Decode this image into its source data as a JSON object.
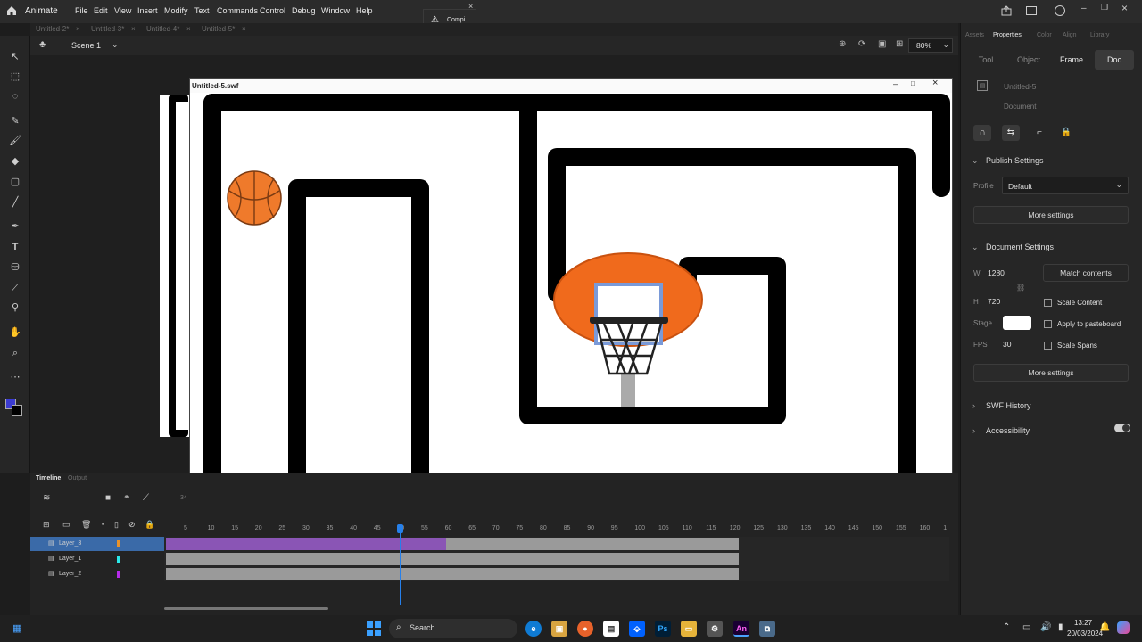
{
  "app": {
    "name": "Animate",
    "menu": [
      "File",
      "Edit",
      "View",
      "Insert",
      "Modify",
      "Text",
      "Commands",
      "Control",
      "Debug",
      "Window",
      "Help"
    ],
    "notification": "Compi..."
  },
  "doc_tabs": [
    "Untitled-2*",
    "Untitled-3*",
    "Untitled-4*",
    "Untitled-5*"
  ],
  "scene": {
    "name": "Scene 1",
    "zoom": "80%"
  },
  "swf_window": {
    "title": "Untitled-5.swf"
  },
  "right_panel": {
    "tabs": [
      "Assets",
      "Properties",
      "Color",
      "Align",
      "Library"
    ],
    "active_tab": "Properties",
    "segments": [
      "Tool",
      "Object",
      "Frame",
      "Doc"
    ],
    "active_segment": "Doc",
    "doc_name": "Untitled-5",
    "doc_type": "Document",
    "publish_settings": {
      "title": "Publish Settings",
      "profile_label": "Profile",
      "profile_value": "Default",
      "more_settings": "More settings"
    },
    "document_settings": {
      "title": "Document Settings",
      "w_label": "W",
      "w_value": "1280",
      "h_label": "H",
      "h_value": "720",
      "match_contents": "Match contents",
      "scale_content": "Scale Content",
      "stage_label": "Stage",
      "stage_color": "#ffffff",
      "apply_to_pasteboard": "Apply to pasteboard",
      "fps_label": "FPS",
      "fps_value": "30",
      "scale_spans": "Scale Spans",
      "more_settings": "More settings"
    },
    "swf_history": "SWF History",
    "accessibility": "Accessibility"
  },
  "timeline": {
    "tabs": [
      "Timeline",
      "Output"
    ],
    "ruler": [
      "5",
      "10",
      "15",
      "20",
      "25",
      "30",
      "35",
      "40",
      "45",
      "50",
      "55",
      "60",
      "65",
      "70",
      "75",
      "80",
      "85",
      "90",
      "95",
      "100",
      "105",
      "110",
      "115",
      "120",
      "125",
      "130",
      "135",
      "140",
      "145",
      "150",
      "155",
      "160",
      "1"
    ],
    "layers": [
      {
        "name": "Layer_3",
        "color": "#e8922a",
        "selected": true
      },
      {
        "name": "Layer_1",
        "color": "#2ae8e8",
        "selected": false
      },
      {
        "name": "Layer_2",
        "color": "#b52ae8",
        "selected": false
      }
    ],
    "playhead_frame": 50,
    "current_label": "34"
  },
  "taskbar": {
    "search_placeholder": "Search",
    "time": "13:27",
    "date": "20/03/2024"
  },
  "colors": {
    "accent": "#2680eb",
    "layer_selected": "#3a6aa8",
    "frame_span_purple": "#8a55b5",
    "frame_span_gray": "#9a9a9a",
    "maze": "#000000",
    "backboard": "#f06a1c"
  }
}
